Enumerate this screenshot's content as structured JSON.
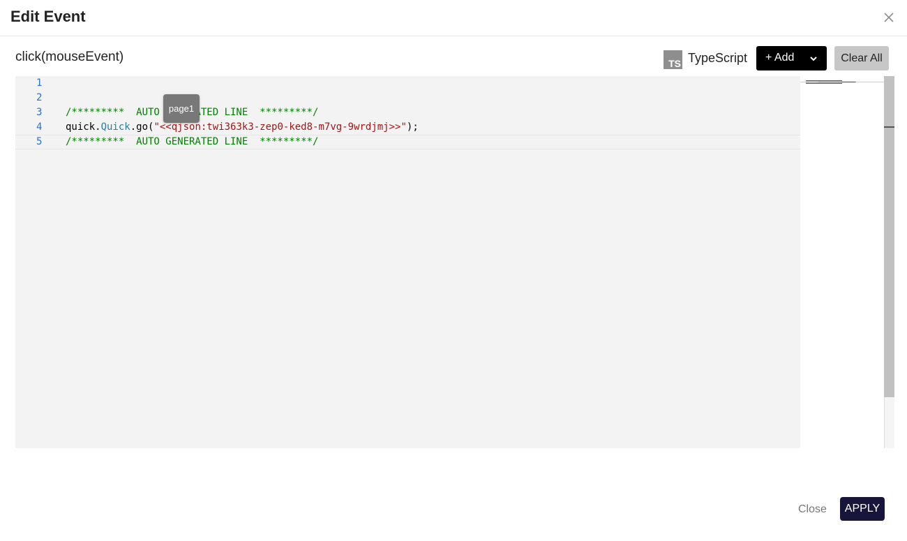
{
  "dialog": {
    "title": "Edit Event",
    "close_icon": "close-icon"
  },
  "toolbar": {
    "event_signature": "click(mouseEvent)",
    "language_icon_text": "TS",
    "language_label": "TypeScript",
    "add_label": "+ Add",
    "add_dropdown_icon": "chevron-down-icon",
    "clear_label": "Clear All"
  },
  "editor": {
    "lines": [
      {
        "number": "1",
        "tokens": []
      },
      {
        "number": "2",
        "tokens": []
      },
      {
        "number": "3",
        "tokens": [
          {
            "text": "/*********  AUTO GENERATED LINE  *********/",
            "kind": "comment"
          }
        ]
      },
      {
        "number": "4",
        "tokens": [
          {
            "text": "quick.",
            "kind": "plain"
          },
          {
            "text": "Quick",
            "kind": "class"
          },
          {
            "text": ".go(",
            "kind": "plain"
          },
          {
            "text": "\"<<qjson:twi363k3-zep0-ked8-m7vg-9wrdjmj>>\"",
            "kind": "string"
          },
          {
            "text": ");",
            "kind": "plain"
          }
        ]
      },
      {
        "number": "5",
        "tokens": [
          {
            "text": "/*********  AUTO GENERATED LINE  *********/",
            "kind": "comment"
          }
        ]
      }
    ],
    "active_line": 5,
    "tooltip": "page1"
  },
  "colors": {
    "comment": "#008000",
    "class": "#267f99",
    "string": "#a31515",
    "line_number": "#2b6fd6",
    "apply_bg": "#17153a"
  },
  "footer": {
    "close_label": "Close",
    "apply_label": "APPLY"
  }
}
